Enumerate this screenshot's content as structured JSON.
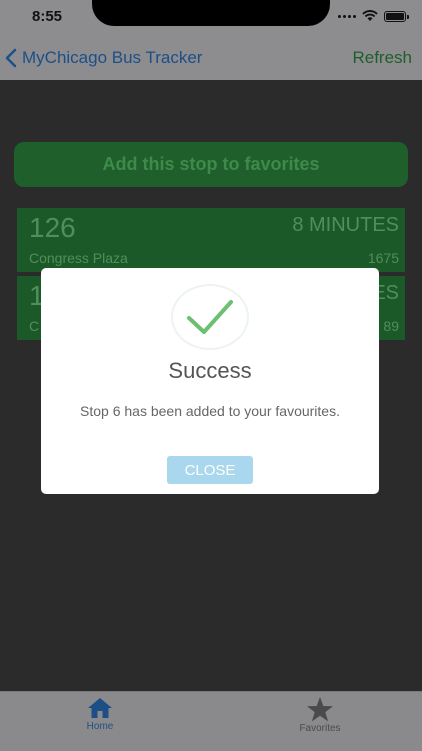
{
  "status_bar": {
    "time": "8:55"
  },
  "nav": {
    "title": "MyChicago Bus Tracker",
    "refresh_label": "Refresh"
  },
  "add_favorite_label": "Add this stop to favorites",
  "arrivals": [
    {
      "route": "126",
      "eta": "8 MINUTES",
      "stop_name": "Congress Plaza",
      "vehicle": "1675"
    },
    {
      "route": "1",
      "eta": "ES",
      "stop_name": "C",
      "vehicle": "89"
    }
  ],
  "dialog": {
    "title": "Success",
    "message": "Stop 6 has been added to your favourites.",
    "close_label": "CLOSE"
  },
  "tabs": [
    {
      "label": "Home",
      "icon": "home-icon",
      "active": true
    },
    {
      "label": "Favorites",
      "icon": "star-icon",
      "active": false
    }
  ],
  "colors": {
    "background": "#2b2b2b",
    "bar_gray": "#8d8d90",
    "accent_blue": "#1d4f86",
    "card_green": "#1b5a28",
    "button_green": "#1e5f2b",
    "check_green": "#6cc070",
    "close_blue": "#a9d7ee"
  }
}
